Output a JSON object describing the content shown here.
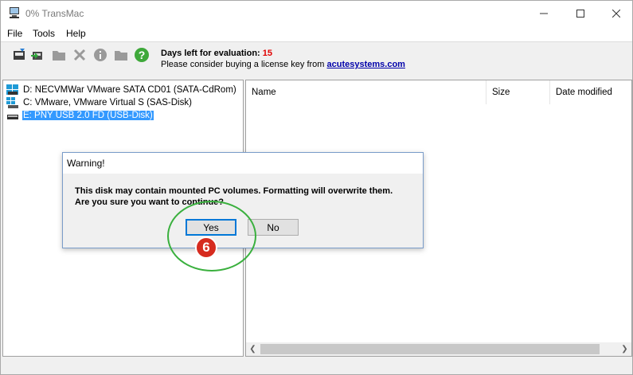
{
  "window": {
    "title": "0% TransMac"
  },
  "menu": {
    "items": [
      "File",
      "Tools",
      "Help"
    ]
  },
  "toolbar": {
    "eval_label": "Days left for evaluation: ",
    "eval_days": "15",
    "license_prefix": "Please consider buying a license key from ",
    "license_link": "acutesystems.com"
  },
  "drives": [
    {
      "label": "D: NECVMWar VMware SATA CD01 (SATA-CdRom)",
      "icon": "cdrom-drive-icon",
      "selected": false
    },
    {
      "label": "C: VMware, VMware Virtual S (SAS-Disk)",
      "icon": "windows-disk-icon",
      "selected": false
    },
    {
      "label": "E: PNY USB 2.0 FD (USB-Disk)",
      "icon": "usb-disk-icon",
      "selected": true
    }
  ],
  "file_list": {
    "columns": [
      "Name",
      "Size",
      "Date modified"
    ]
  },
  "dialog": {
    "title": "Warning!",
    "line1": "This disk may contain mounted PC volumes. Formatting will overwrite them.",
    "line2": "Are you sure you want to continue?",
    "yes_label": "Yes",
    "no_label": "No"
  },
  "annotation": {
    "step": "6",
    "color": "#3ab03e",
    "badge_color": "#d62b1f"
  },
  "colors": {
    "selection": "#3399ff",
    "accent": "#0078d7",
    "eval_days": "#e00000",
    "link": "#0000aa"
  }
}
